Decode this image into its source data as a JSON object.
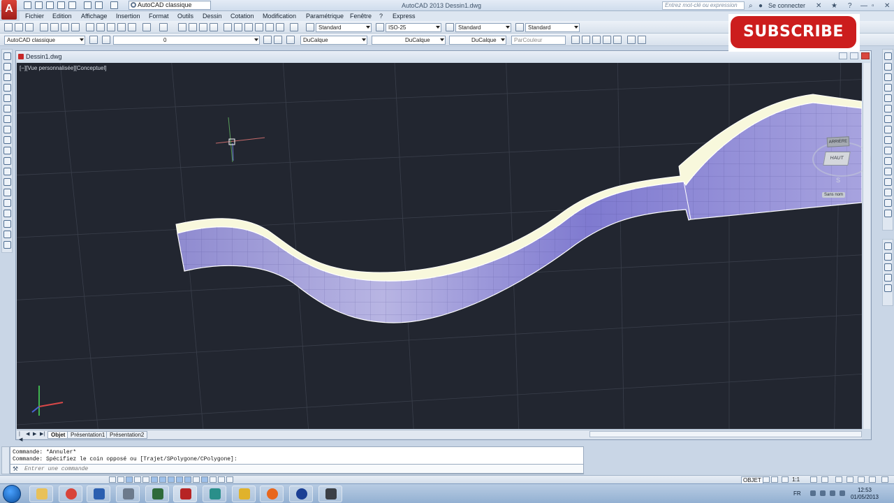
{
  "titlebar": {
    "app_logo": "A",
    "workspace": "AutoCAD classique",
    "title": "AutoCAD 2013   Dessin1.dwg",
    "search_placeholder": "Entrez mot-clé ou expression",
    "signin": "Se connecter"
  },
  "menu": [
    "Fichier",
    "Edition",
    "Affichage",
    "Insertion",
    "Format",
    "Outils",
    "Dessin",
    "Cotation",
    "Modification",
    "Paramétrique",
    "Fenêtre",
    "?",
    "Express"
  ],
  "styles_toolbar": {
    "text_style": "Standard",
    "dim_style": "ISO-25",
    "table_style": "Standard",
    "multileader_style": "Standard"
  },
  "layers_toolbar": {
    "workspace": "AutoCAD classique",
    "layer": "0",
    "color": "DuCalque",
    "linetype": "DuCalque",
    "lineweight": "DuCalque",
    "plotstyle": "ParCouleur"
  },
  "drawing": {
    "tab_title": "Dessin1.dwg",
    "viewport_label": "[−][Vue personnalisée][Conceptuel]",
    "viewcube": {
      "top": "HAUT",
      "front": "ARRIÈRE",
      "compass_s": "S",
      "wcs": "Sans nom"
    }
  },
  "layout_tabs": [
    "Objet",
    "Présentation1",
    "Présentation2"
  ],
  "command": {
    "history": [
      "Commande: *Annuler*",
      "Commande: Spécifiez le coin opposé ou [Trajet/SPolygone/CPolygone]:"
    ],
    "input_placeholder": "Entrer une commande"
  },
  "statusbar": {
    "model_label": "OBJET",
    "scale": "1:1"
  },
  "taskbar": {
    "language": "FR",
    "time": "12:53",
    "date": "01/05/2013",
    "apps": [
      "explorer",
      "chrome",
      "autocad-ws",
      "app-3",
      "app-4",
      "autocad-2013",
      "app-6",
      "app-7",
      "app-8",
      "app-9",
      "app-10"
    ]
  },
  "overlay": {
    "subscribe": "SUBSCRIBE"
  },
  "colors": {
    "viewport_bg": "#222630",
    "surface_fill": "#9a96d8",
    "surface_edge": "#fbfbe6",
    "subscribe_red": "#cc1d1d"
  }
}
